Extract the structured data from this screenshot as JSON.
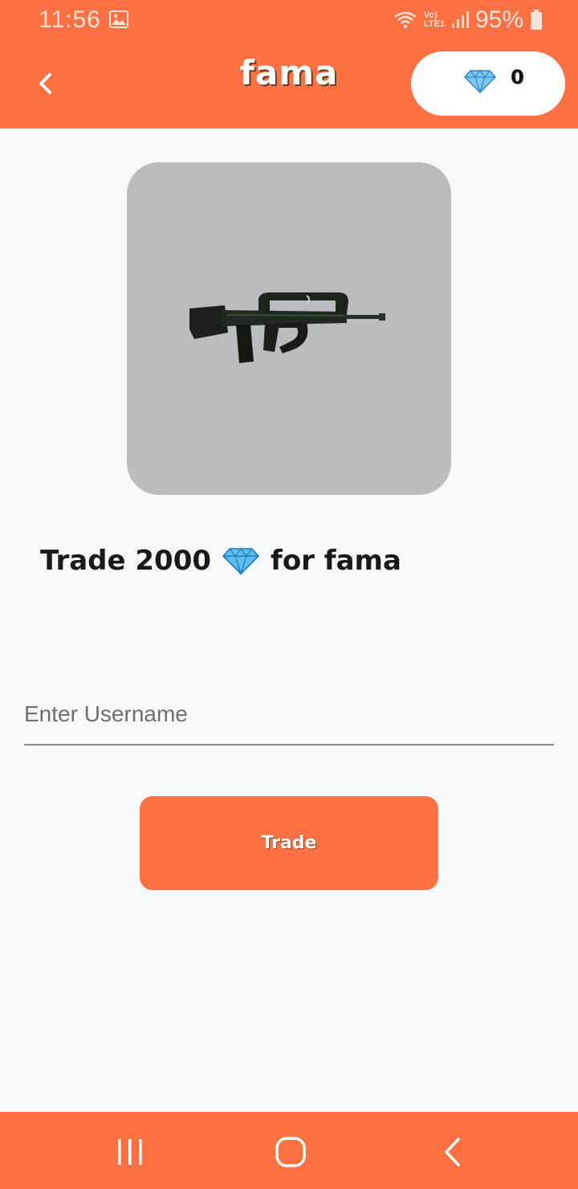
{
  "status_bar": {
    "time": "11:56",
    "network_line1": "Vo)",
    "network_line2": "LTE1",
    "battery": "95%"
  },
  "header": {
    "title": "fama",
    "gem_count": "0"
  },
  "item": {
    "trade_prefix": "Trade 2000",
    "trade_suffix": "for fama"
  },
  "form": {
    "username_placeholder": "Enter Username",
    "username_value": "",
    "trade_button_label": "Trade"
  },
  "colors": {
    "accent": "#ff7043",
    "card": "#bbbcbe",
    "background": "#f8f9fa"
  },
  "icons": {
    "back": "chevron-left-icon",
    "gem": "diamond-icon",
    "nav_recents": "recents-icon",
    "nav_home": "home-icon",
    "nav_back": "back-icon"
  }
}
